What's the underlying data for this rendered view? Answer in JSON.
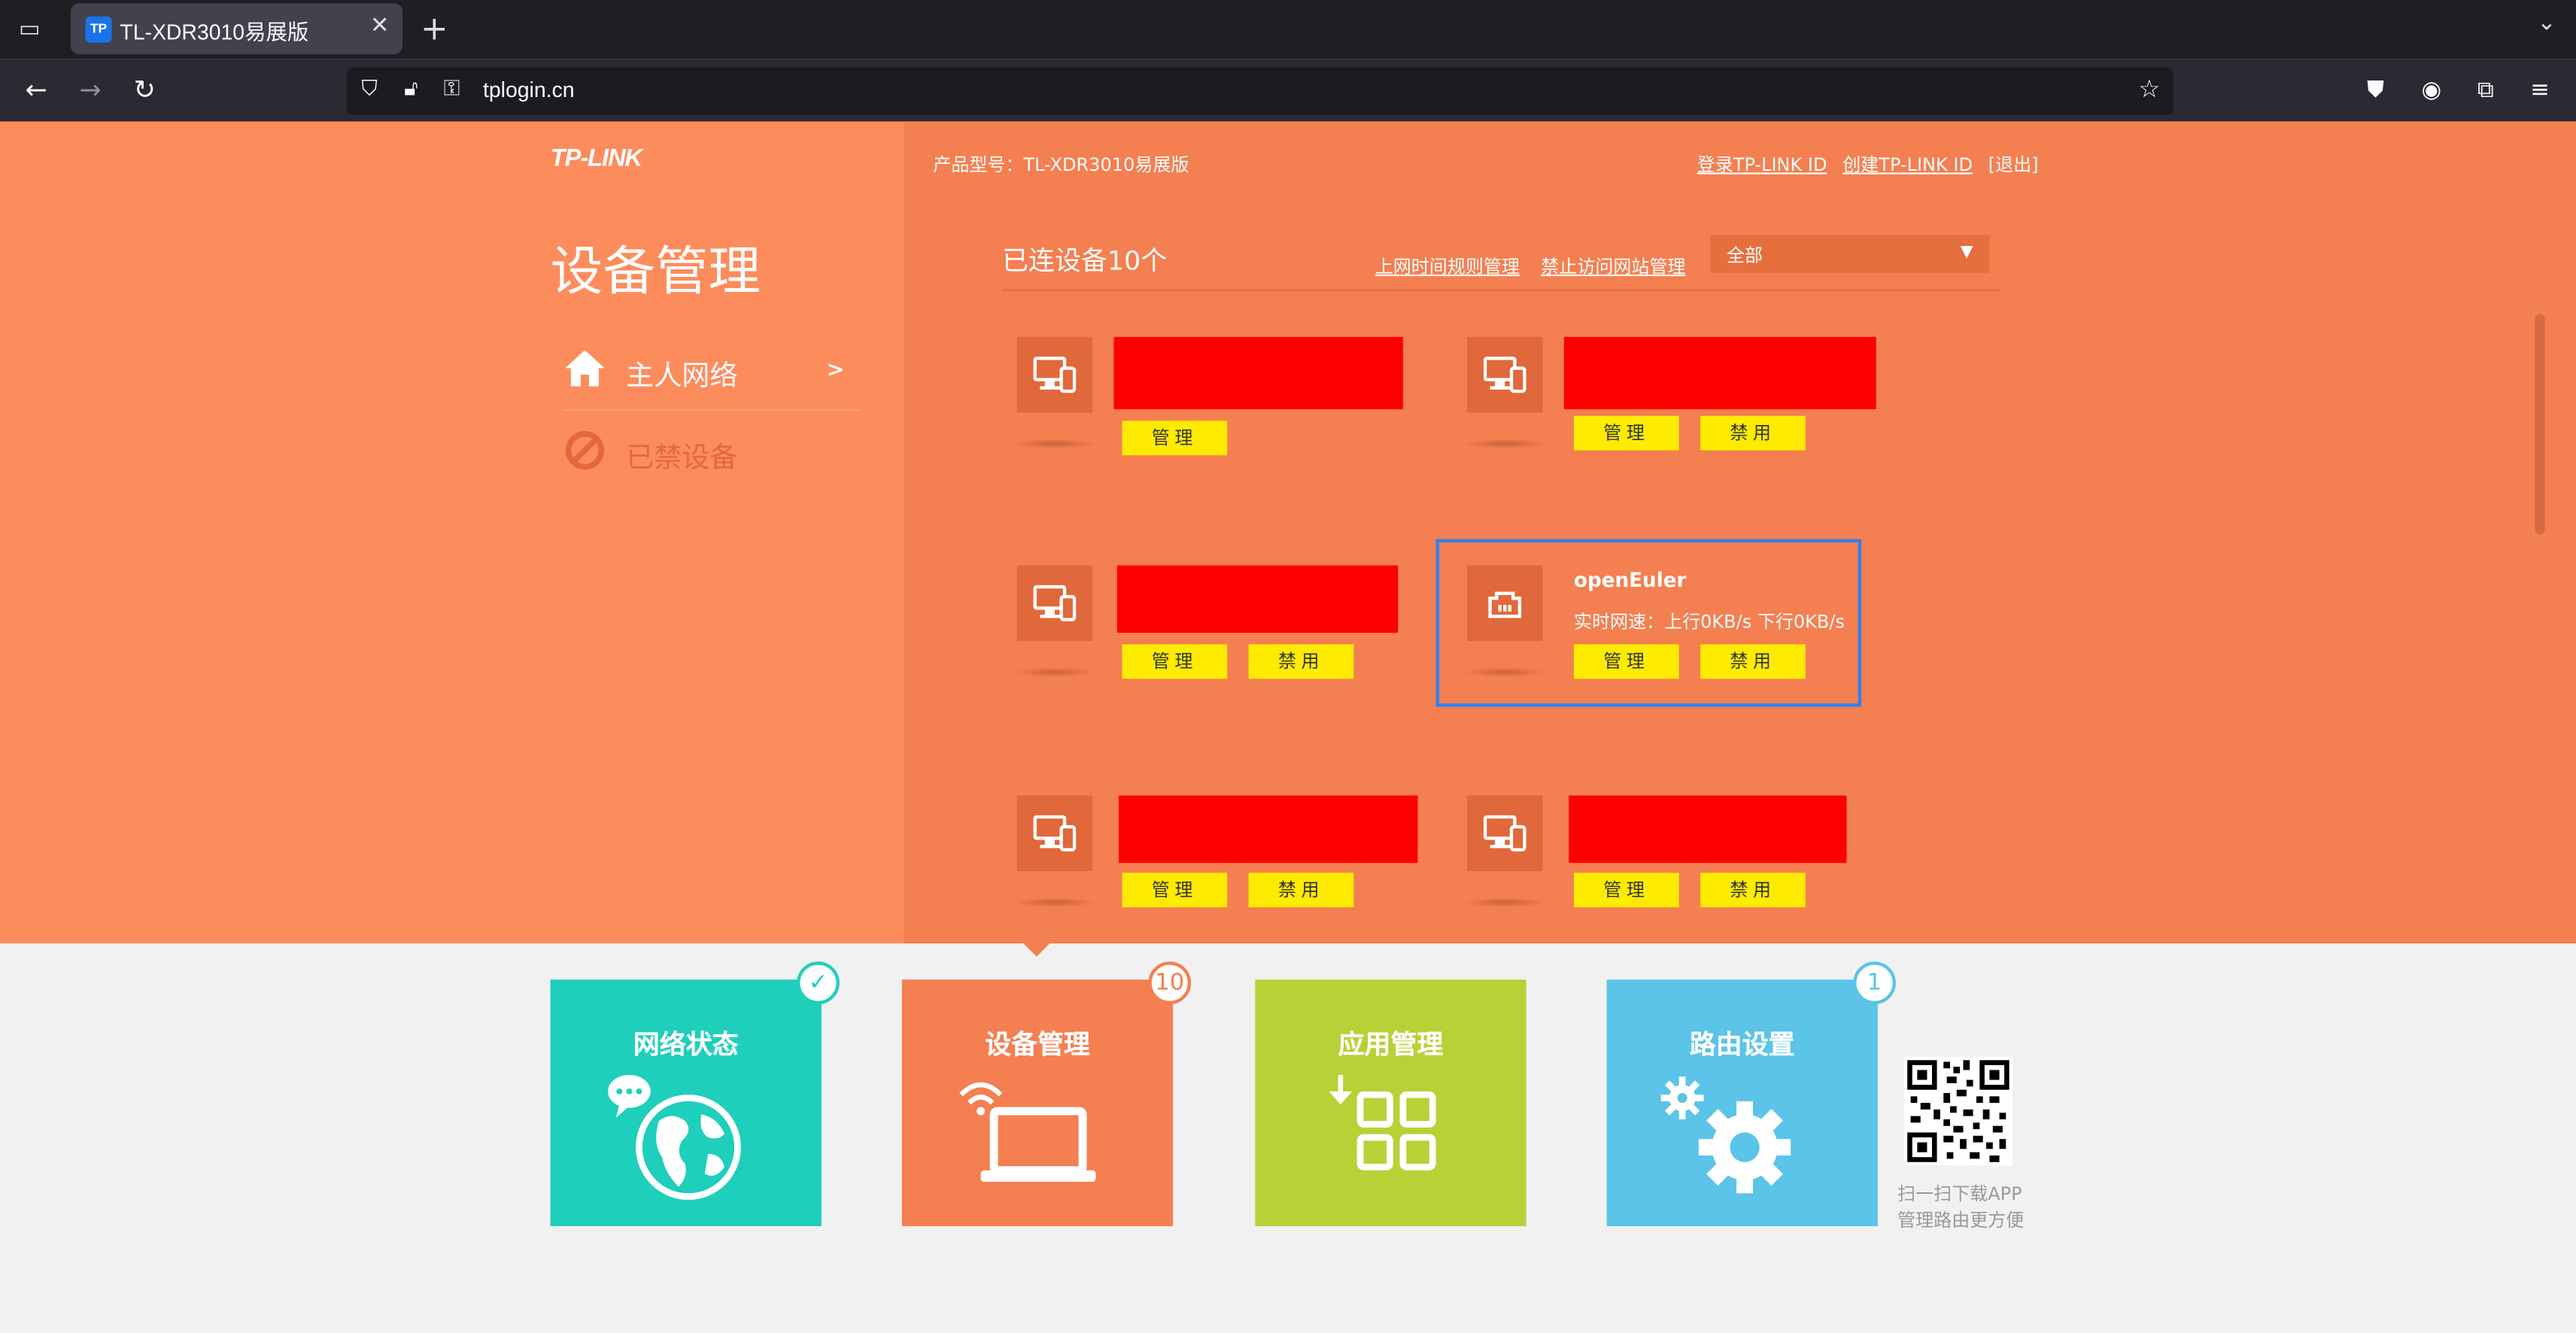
{
  "browser": {
    "tab_title": "TL-XDR3010易展版",
    "tab_favicon": "TP",
    "url": "tplogin.cn"
  },
  "brand": {
    "logo": "TP-LINK",
    "color": "#f47f51"
  },
  "header": {
    "model_label": "产品型号：TL-XDR3010易展版",
    "login_link": "登录TP-LINK ID",
    "create_link": "创建TP-LINK ID",
    "logout_link": "[退出]"
  },
  "sidebar": {
    "title": "设备管理",
    "items": [
      {
        "label": "主人网络",
        "arrow": ">"
      },
      {
        "label": "已禁设备"
      }
    ]
  },
  "main": {
    "connected_title": "已连设备10个",
    "link_schedule": "上网时间规则管理",
    "link_block_sites": "禁止访问网站管理",
    "filter_value": "全部"
  },
  "devices": [
    {
      "name": "",
      "manage": "管理"
    },
    {
      "name": "",
      "manage": "管理",
      "disable": "禁用"
    },
    {
      "name": "",
      "manage": "管理",
      "disable": "禁用"
    },
    {
      "name": "openEuler",
      "speed": "实时网速：上行0KB/s 下行0KB/s",
      "manage": "管理",
      "disable": "禁用"
    },
    {
      "name": "",
      "manage": "管理",
      "disable": "禁用"
    },
    {
      "name": "",
      "manage": "管理",
      "disable": "禁用"
    }
  ],
  "tiles": [
    {
      "label": "网络状态",
      "color": "#1ecfbb",
      "badge": "✓",
      "badge_color": "#1ecfbb"
    },
    {
      "label": "设备管理",
      "color": "#f47f51",
      "badge": "10",
      "badge_color": "#f47f51"
    },
    {
      "label": "应用管理",
      "color": "#b7d237"
    },
    {
      "label": "路由设置",
      "color": "#5bc4e8",
      "badge": "1",
      "badge_color": "#5bc4e8"
    }
  ],
  "qr": {
    "line1": "扫一扫下载APP",
    "line2": "管理路由更方便"
  }
}
